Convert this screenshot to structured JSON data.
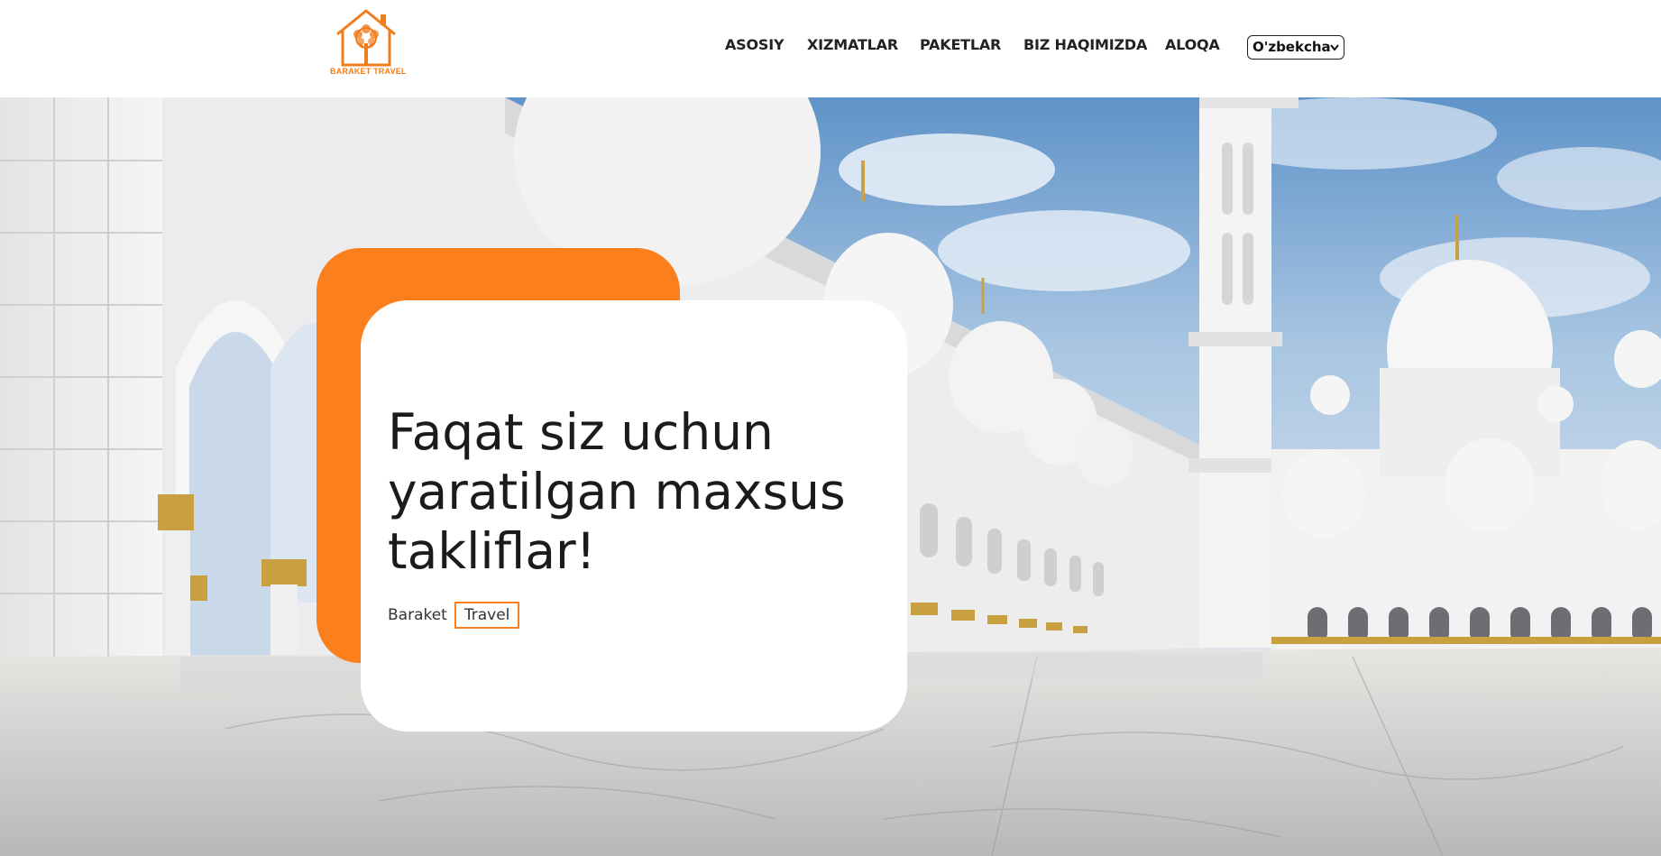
{
  "brand": {
    "logo_text": "BARAKET TRAVEL",
    "accent_color": "#fb7f1c"
  },
  "nav": {
    "items": [
      "ASOSIY",
      "XIZMATLAR",
      "PAKETLAR",
      "BIZ HAQIMIZDA",
      "ALOQA"
    ],
    "language": "O'zbekcha"
  },
  "hero": {
    "title": "Faqat siz uchun yaratilgan maxsus takliflar!",
    "brand_first": "Baraket",
    "brand_second": "Travel",
    "background": "mosque-photo"
  }
}
